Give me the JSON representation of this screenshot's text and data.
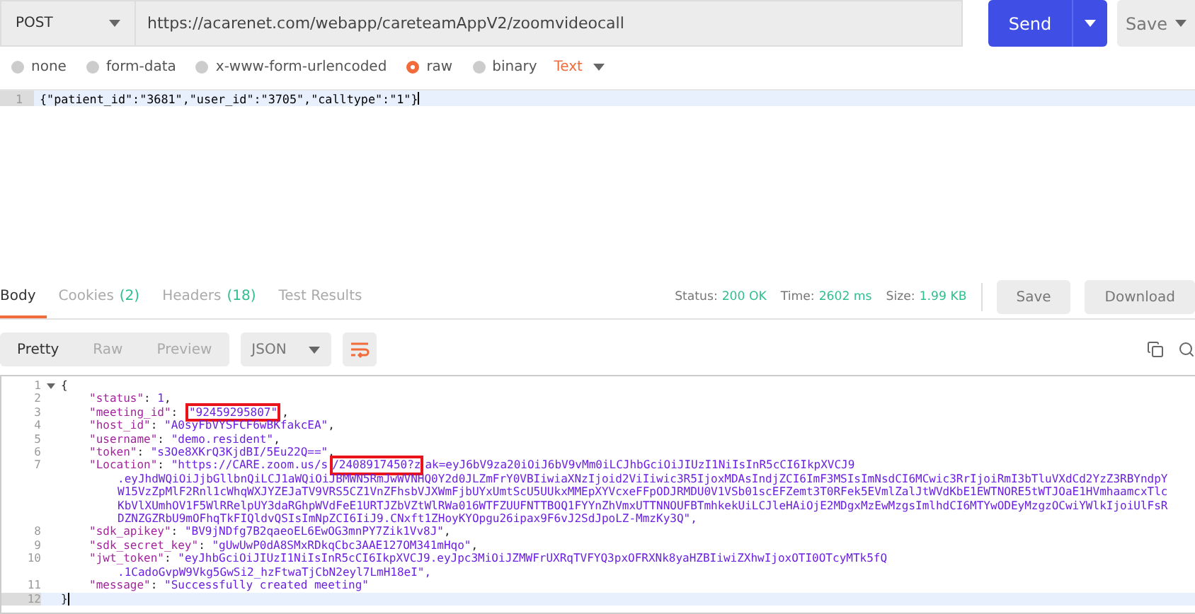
{
  "request": {
    "method": "POST",
    "url": "https://acarenet.com/webapp/careteamAppV2/zoomvideocall",
    "send": "Send",
    "save": "Save"
  },
  "body_types": [
    {
      "label": "none",
      "selected": false,
      "kind": "radio"
    },
    {
      "label": "form-data",
      "selected": false,
      "kind": "radio"
    },
    {
      "label": "x-www-form-urlencoded",
      "selected": false,
      "kind": "radio"
    },
    {
      "label": "raw",
      "selected": true,
      "kind": "radio"
    },
    {
      "label": "binary",
      "selected": false,
      "kind": "radio"
    },
    {
      "label": "Text",
      "selected": false,
      "kind": "dropdown"
    }
  ],
  "request_body": [
    {
      "number": "1",
      "active": true,
      "text": "{\"patient_id\":\"3681\",\"user_id\":\"3705\",\"calltype\":\"1\"}"
    }
  ],
  "response_tabs": [
    {
      "label": "Body",
      "selected": true
    },
    {
      "label": "Cookies",
      "count": "(2)",
      "selected": false
    },
    {
      "label": "Headers",
      "count": "(18)",
      "selected": false
    },
    {
      "label": "Test Results",
      "selected": false
    }
  ],
  "response_stats": [
    {
      "label": "Status:",
      "value": "200 OK"
    },
    {
      "label": "Time:",
      "value": "2602 ms"
    },
    {
      "label": "Size:",
      "value": "1.99 KB"
    }
  ],
  "response_actions": [
    "Save",
    "Download"
  ],
  "view_modes": [
    {
      "label": "Pretty",
      "selected": true
    },
    {
      "label": "Raw",
      "selected": false
    },
    {
      "label": "Preview",
      "selected": false
    }
  ],
  "format": "JSON",
  "response_lines": [
    {
      "number": "1",
      "fold": true,
      "active": false,
      "parts": [
        {
          "kind": "punct",
          "text": "{"
        }
      ]
    },
    {
      "number": "2",
      "active": false,
      "parts": [
        {
          "kind": "key",
          "text": "\"status\""
        },
        {
          "kind": "punct",
          "text": ": "
        },
        {
          "kind": "number",
          "text": "1"
        },
        {
          "kind": "punct",
          "text": ","
        }
      ]
    },
    {
      "number": "3",
      "active": false,
      "parts": [
        {
          "kind": "key",
          "text": "\"meeting_id\""
        },
        {
          "kind": "punct",
          "text": ": "
        },
        {
          "kind": "string",
          "text": "\"92459295807\"",
          "boxed": true
        },
        {
          "kind": "punct",
          "text": ","
        }
      ]
    },
    {
      "number": "4",
      "active": false,
      "parts": [
        {
          "kind": "key",
          "text": "\"host_id\""
        },
        {
          "kind": "punct",
          "text": ": "
        },
        {
          "kind": "string",
          "text": "\"A0syFbVYSFCF6wBKfakcEA\""
        },
        {
          "kind": "punct",
          "text": ","
        }
      ]
    },
    {
      "number": "5",
      "active": false,
      "parts": [
        {
          "kind": "key",
          "text": "\"username\""
        },
        {
          "kind": "punct",
          "text": ": "
        },
        {
          "kind": "string",
          "text": "\"demo.resident\""
        },
        {
          "kind": "punct",
          "text": ","
        }
      ]
    },
    {
      "number": "6",
      "active": false,
      "parts": [
        {
          "kind": "key",
          "text": "\"token\""
        },
        {
          "kind": "punct",
          "text": ": "
        },
        {
          "kind": "string",
          "text": "\"s3Oe8XKrQ3KjdBI/5Eu22Q==\""
        },
        {
          "kind": "punct",
          "text": ","
        }
      ]
    },
    {
      "number": "7",
      "active": false,
      "parts": [
        {
          "kind": "key",
          "text": "\"Location\""
        },
        {
          "kind": "punct",
          "text": ": "
        },
        {
          "kind": "string",
          "text": "\"https://CARE.zoom.us/s"
        },
        {
          "kind": "string",
          "text": "/2408917450?z",
          "boxed": true
        },
        {
          "kind": "string",
          "text": "ak=eyJ6bV9za20iOiJ6bV9vMm0iLCJhbGciOiJIUzI1NiIsInR5cCI6IkpXVCJ9"
        }
      ],
      "wrapped": [
        ".eyJhdWQiOiJjbGllbnQiLCJ1aWQiOiJBMWN5RmJwWVNHQ0Y2d0JLZmFrY0VBIiwiaXNzIjoid2ViIiwic3R5IjoxMDAsIndjZCI6ImF3MSIsImNsdCI6MCwic3RrIjoiRmI3bTluVXdCd2YzZ3RBYndpY",
        "W15VzZpMlF2Rnl1cWhqWXJYZEJaTV9VRS5CZ1VnZFhsbVJXWmFjbUYxUmtScU5UUkxMMEpXYVcxeFFpODJRMDU0V1VSb01scEFZemt3T0RFek5EVmlZalJtWVdKbE1EWTNORE5tWTJOaE1HVmhaamcxTlc",
        "KbVlXUmhOV1F5WlRRelpUY3daRGhpWVdFeE1URTJZbVZtWlRWa016WTFZUUFNTTBOQ1FYYnZhVmxUTTNNOUFBTmhkekUiLCJleHAiOjE2MDgxMzEwMzgsImlhdCI6MTYwODEyMzgzOCwiYWlkIjoiUlFsR",
        "DZNZGZRbU9mOFhqTkFIQldvQSIsImNpZCI6IiJ9.CNxft1ZHoyKYOpgu26ipax9F6vJ2SdJpoLZ-MmzKy3Q\","
      ]
    },
    {
      "number": "8",
      "active": false,
      "parts": [
        {
          "kind": "key",
          "text": "\"sdk_apikey\""
        },
        {
          "kind": "punct",
          "text": ": "
        },
        {
          "kind": "string",
          "text": "\"BV9jNDfg7B2qaeoEL6EwOG3mnPY7Zik1Vv8J\""
        },
        {
          "kind": "punct",
          "text": ","
        }
      ]
    },
    {
      "number": "9",
      "active": false,
      "parts": [
        {
          "kind": "key",
          "text": "\"sdk_secret_key\""
        },
        {
          "kind": "punct",
          "text": ": "
        },
        {
          "kind": "string",
          "text": "\"gUwUwP0dA8SMxRDkqCbc3AAE127OM341mHqo\""
        },
        {
          "kind": "punct",
          "text": ","
        }
      ]
    },
    {
      "number": "10",
      "active": false,
      "parts": [
        {
          "kind": "key",
          "text": "\"jwt_token\""
        },
        {
          "kind": "punct",
          "text": ": "
        },
        {
          "kind": "string",
          "text": "\"eyJhbGciOiJIUzI1NiIsInR5cCI6IkpXVCJ9.eyJpc3MiOiJZMWFrUXRqTVFYQ3pxOFRXNk8yaHZBIiwiZXhwIjoxOTI0OTcyMTk5fQ"
        }
      ],
      "wrapped": [
        ".1CadoGvpW9Vkg5GwSi2_hzFtwaTjCbN2eyl7LmH18eI\","
      ]
    },
    {
      "number": "11",
      "active": false,
      "parts": [
        {
          "kind": "key",
          "text": "\"message\""
        },
        {
          "kind": "punct",
          "text": ": "
        },
        {
          "kind": "string",
          "text": "\"Successfully created meeting\""
        }
      ]
    },
    {
      "number": "12",
      "active": true,
      "parts": [
        {
          "kind": "punct",
          "text": "}"
        }
      ]
    }
  ]
}
